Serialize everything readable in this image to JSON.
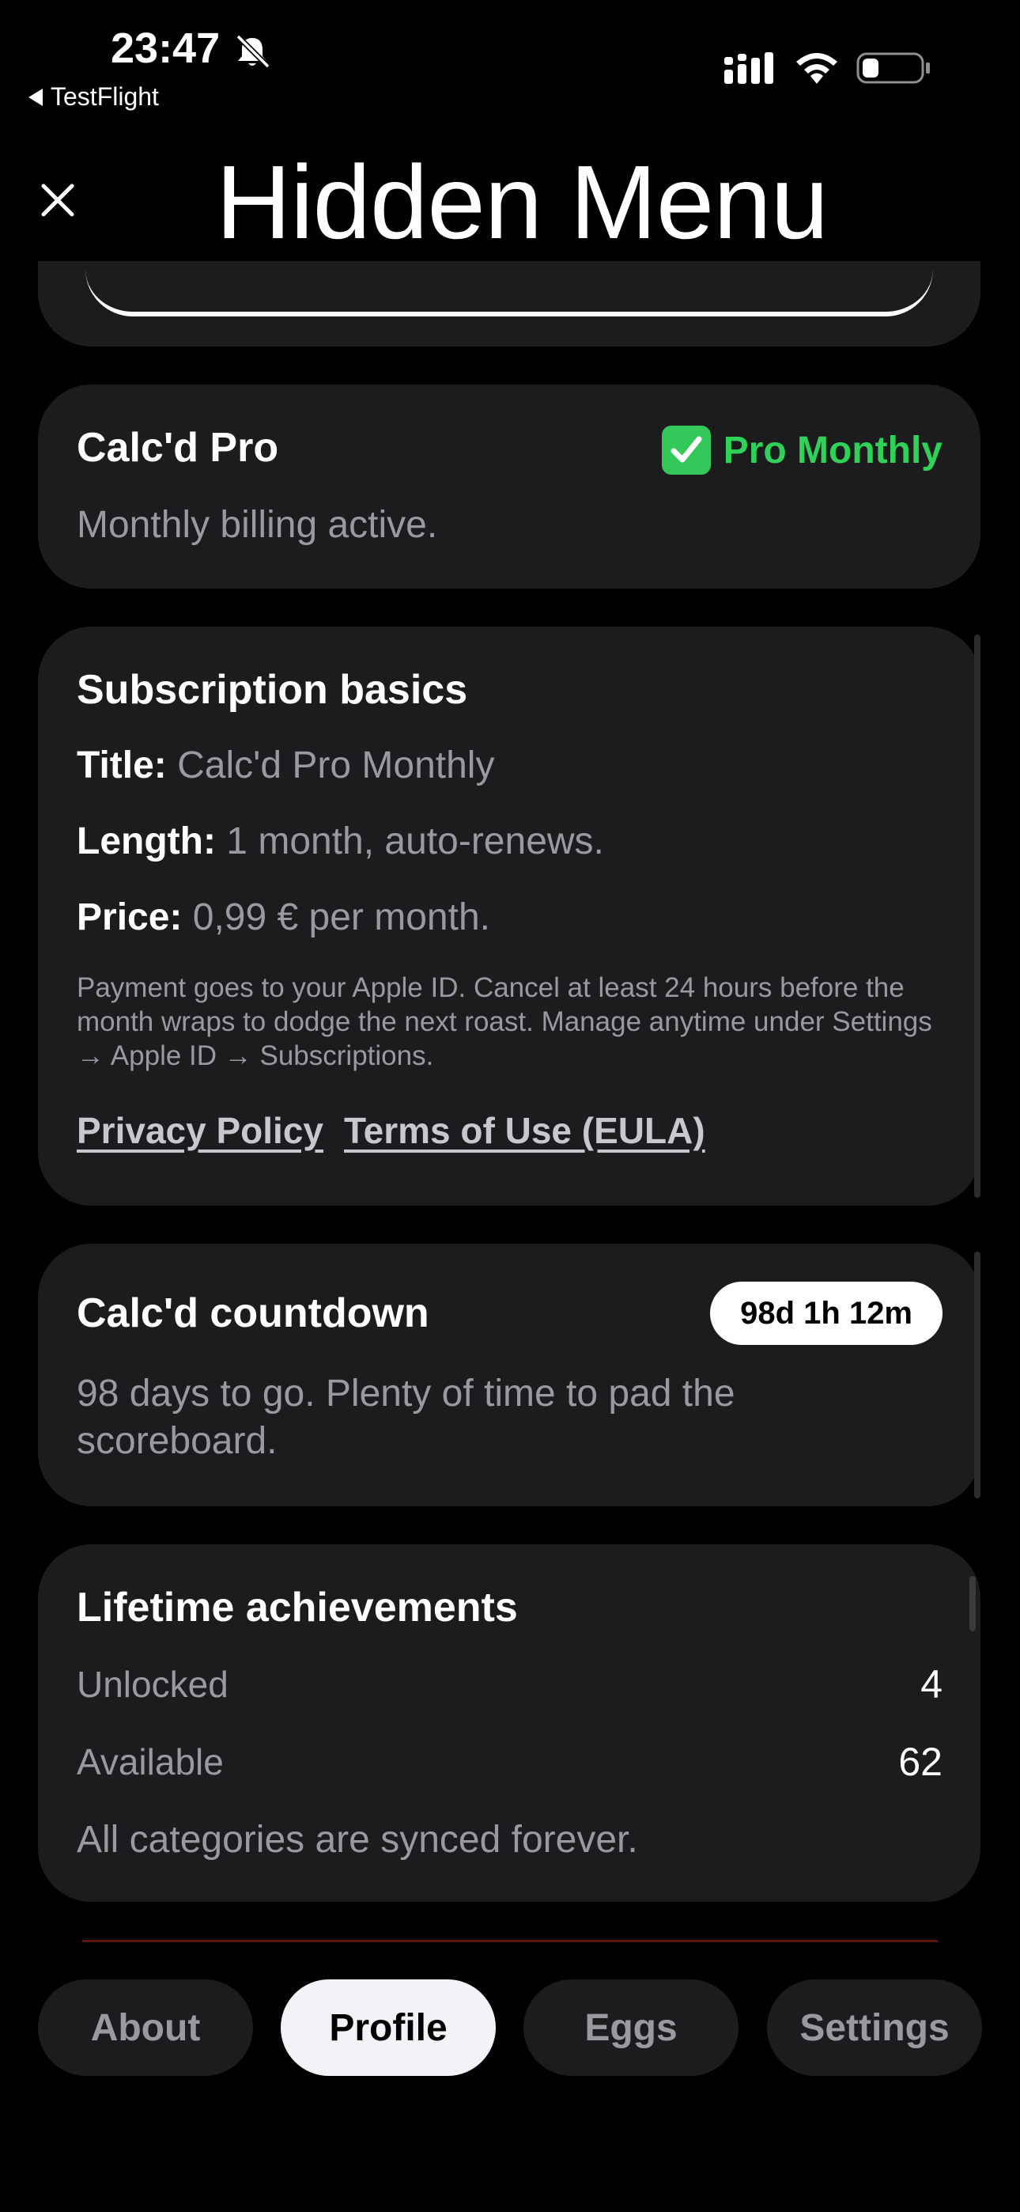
{
  "status_bar": {
    "time": "23:47",
    "back_label": "TestFlight"
  },
  "header": {
    "title": "Hidden Menu"
  },
  "pro_card": {
    "title": "Calc'd Pro",
    "badge_icon": "✅",
    "badge_label": "Pro Monthly",
    "description": "Monthly billing active."
  },
  "subscription": {
    "heading": "Subscription basics",
    "title_label": "Title:",
    "title_value": "Calc'd Pro Monthly",
    "length_label": "Length:",
    "length_value": "1 month, auto-renews.",
    "price_label": "Price:",
    "price_value": "0,99 € per month.",
    "fine_print": "Payment goes to your Apple ID. Cancel at least 24 hours before the month wraps to dodge the next roast. Manage anytime under Settings → Apple ID → Subscriptions.",
    "privacy_link": "Privacy Policy",
    "terms_link": "Terms of Use (EULA)"
  },
  "countdown": {
    "title": "Calc'd countdown",
    "badge": "98d 1h 12m",
    "text": "98 days to go. Plenty of time to pad the scoreboard."
  },
  "achievements": {
    "title": "Lifetime achievements",
    "unlocked_label": "Unlocked",
    "unlocked_value": "4",
    "available_label": "Available",
    "available_value": "62",
    "note": "All categories are synced forever."
  },
  "tabs": [
    {
      "label": "About",
      "active": false
    },
    {
      "label": "Profile",
      "active": true
    },
    {
      "label": "Eggs",
      "active": false
    },
    {
      "label": "Settings",
      "active": false
    }
  ],
  "colors": {
    "background": "#000000",
    "card": "#1c1c1e",
    "accent_green": "#30d158",
    "secondary_text": "#9a9a9e"
  }
}
